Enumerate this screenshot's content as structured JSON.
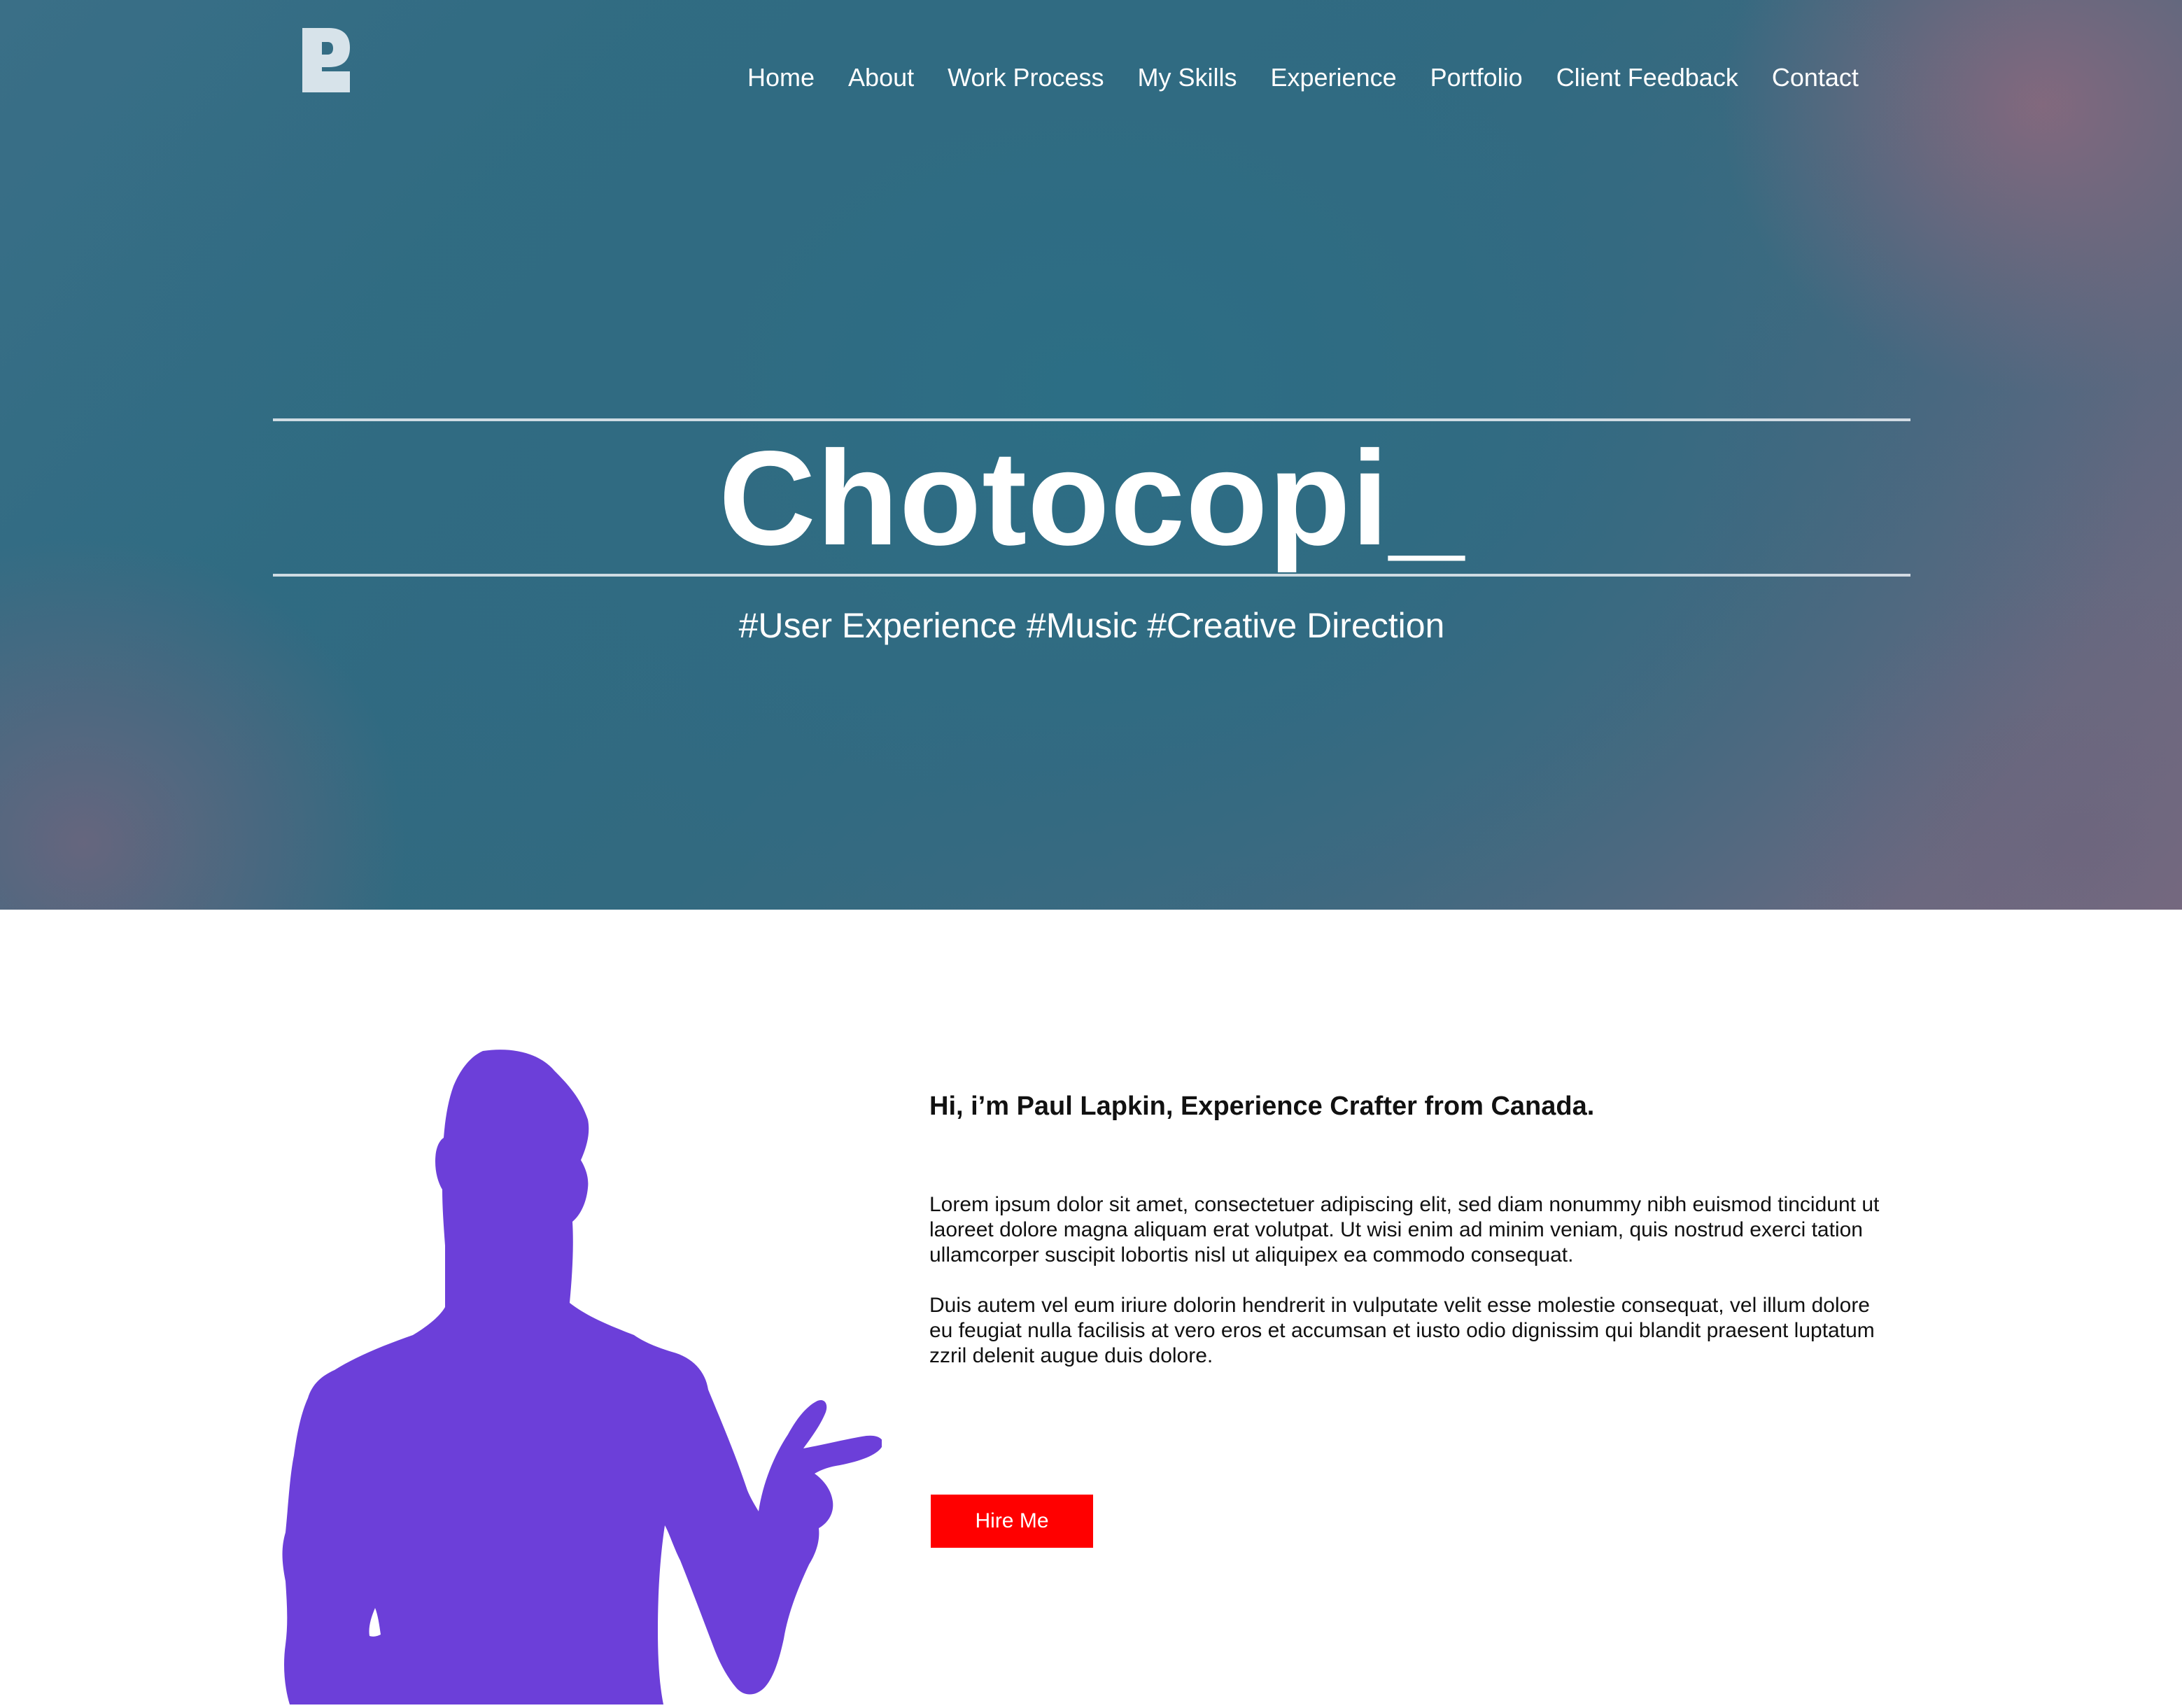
{
  "brand": {
    "logo_icon": "p-monogram-logo-icon"
  },
  "nav": {
    "items": [
      {
        "label": "Home"
      },
      {
        "label": "About"
      },
      {
        "label": "Work Process"
      },
      {
        "label": "My Skills"
      },
      {
        "label": "Experience"
      },
      {
        "label": "Portfolio"
      },
      {
        "label": "Client Feedback"
      },
      {
        "label": "Contact"
      }
    ]
  },
  "hero": {
    "title": "Chotocopi_",
    "tags": "#User Experience #Music #Creative Direction"
  },
  "about": {
    "portrait_icon": "person-silhouette-pointing",
    "heading": "Hi, i’m Paul Lapkin, Experience Crafter from Canada.",
    "paragraphs": [
      "Lorem ipsum dolor sit amet, consectetuer adipiscing elit, sed diam nonummy nibh euismod tincidunt ut laoreet dolore magna aliquam erat volutpat. Ut wisi enim ad minim veniam, quis nostrud exerci tation ullamcorper suscipit lobortis nisl ut aliquipex ea commodo consequat.",
      "Duis autem vel eum iriure dolorin hendrerit in vulputate velit esse molestie consequat, vel illum dolore eu feugiat nulla facilisis at vero eros et accumsan et iusto odio dignissim qui blandit praesent luptatum zzril delenit augue duis dolore."
    ],
    "cta_label": "Hire Me"
  },
  "colors": {
    "hero_teal": "#2f6b82",
    "hero_mauve": "#7a6a80",
    "silhouette": "#6c3fd9",
    "cta": "#ff0000",
    "text": "#111111"
  }
}
